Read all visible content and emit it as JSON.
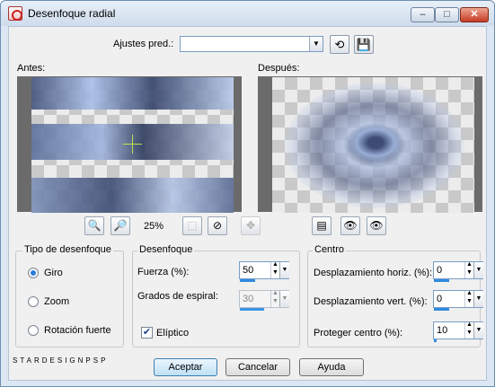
{
  "window": {
    "title": "Desenfoque radial",
    "controls": {
      "minimize": "–",
      "maximize": "□",
      "close": "✕"
    }
  },
  "presets": {
    "label": "Ajustes pred.:",
    "value": ""
  },
  "previews": {
    "before_label": "Antes:",
    "after_label": "Después:"
  },
  "zoom": {
    "value": "25%"
  },
  "blur_type": {
    "title": "Tipo de desenfoque",
    "options": [
      {
        "label": "Giro",
        "selected": true
      },
      {
        "label": "Zoom",
        "selected": false
      },
      {
        "label": "Rotación fuerte",
        "selected": false
      }
    ]
  },
  "blur": {
    "title": "Desenfoque",
    "strength_label": "Fuerza (%):",
    "strength_value": "50",
    "strength_level": 0.5,
    "spiral_label": "Grados de espiral:",
    "spiral_value": "30",
    "spiral_level": 0.83,
    "elliptic_label": "Elíptico",
    "elliptic_checked": true
  },
  "center": {
    "title": "Centro",
    "hshift_label": "Desplazamiento horiz. (%):",
    "hshift_value": "0",
    "hshift_level": 0.5,
    "vshift_label": "Desplazamiento vert. (%):",
    "vshift_value": "0",
    "vshift_level": 0.5,
    "protect_label": "Proteger centro (%):",
    "protect_value": "10",
    "protect_level": 0.1
  },
  "brand_text": "STARDESIGNPSP",
  "buttons": {
    "ok": "Aceptar",
    "cancel": "Cancelar",
    "help": "Ayuda"
  },
  "icons": {
    "undo": "undo-icon",
    "save": "save-icon",
    "zoom_out": "zoom-out-icon",
    "zoom_in": "zoom-in-icon",
    "fit": "fit-icon",
    "pan": "pan-icon",
    "move": "move-icon",
    "proof": "proof-icon",
    "lock_preview": "lock-preview-icon",
    "auto_proof": "auto-proof-icon"
  }
}
